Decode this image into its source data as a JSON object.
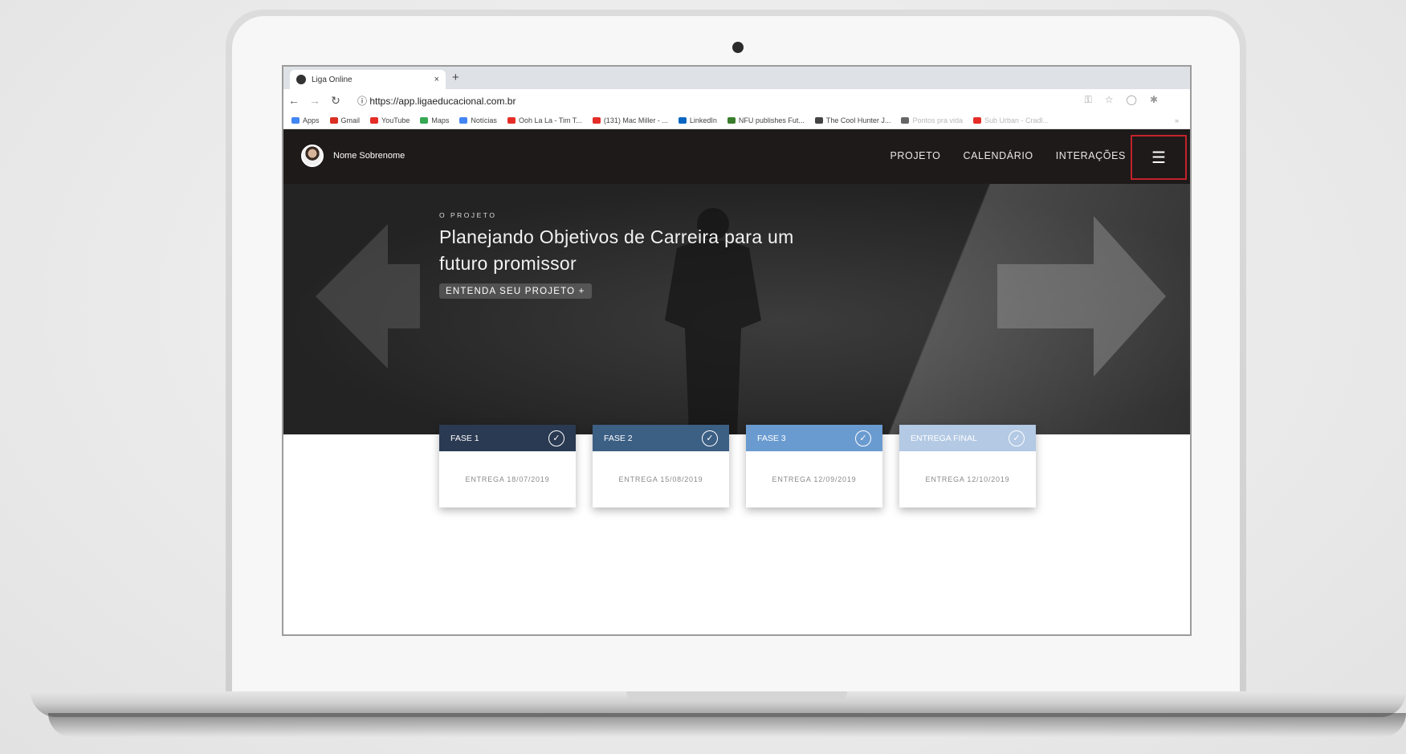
{
  "browser": {
    "tab_title": "Liga Online",
    "tab_close": "×",
    "new_tab": "+",
    "url": "https://app.ligaeducacional.com.br",
    "bookmarks": [
      {
        "label": "Apps",
        "color": "#4285f4"
      },
      {
        "label": "Gmail",
        "color": "#d93025"
      },
      {
        "label": "YouTube",
        "color": "#e52d27"
      },
      {
        "label": "Maps",
        "color": "#34a853"
      },
      {
        "label": "Notícias",
        "color": "#4285f4"
      },
      {
        "label": "Ooh La La - Tim T...",
        "color": "#e52d27"
      },
      {
        "label": "(131) Mac Miller - ...",
        "color": "#e52d27"
      },
      {
        "label": "LinkedIn",
        "color": "#0a66c2"
      },
      {
        "label": "NFU publishes Fut...",
        "color": "#3a7d2c"
      },
      {
        "label": "The Cool Hunter J...",
        "color": "#444444"
      },
      {
        "label": "Pontos pra vida",
        "color": "#666666"
      },
      {
        "label": "Sub Urban - Cradl...",
        "color": "#e52d27"
      }
    ],
    "more": "»"
  },
  "app": {
    "user_name": "Nome Sobrenome",
    "menu": [
      "PROJETO",
      "CALENDÁRIO",
      "INTERAÇÕES"
    ],
    "hamburger": "☰",
    "hamburger_highlight": "#c4222b"
  },
  "hero": {
    "eyebrow": "O PROJETO",
    "title": "Planejando Objetivos de Carreira para um futuro promissor",
    "cta": "ENTENDA SEU PROJETO +"
  },
  "phases": [
    {
      "label": "FASE 1",
      "date": "ENTREGA 18/07/2019",
      "color": "#2a3a52"
    },
    {
      "label": "FASE 2",
      "date": "ENTREGA 15/08/2019",
      "color": "#3c5f84"
    },
    {
      "label": "FASE 3",
      "date": "ENTREGA 12/09/2019",
      "color": "#6a9bd0"
    },
    {
      "label": "ENTREGA FINAL",
      "date": "ENTREGA 12/10/2019",
      "color": "#b3c9e4"
    }
  ]
}
